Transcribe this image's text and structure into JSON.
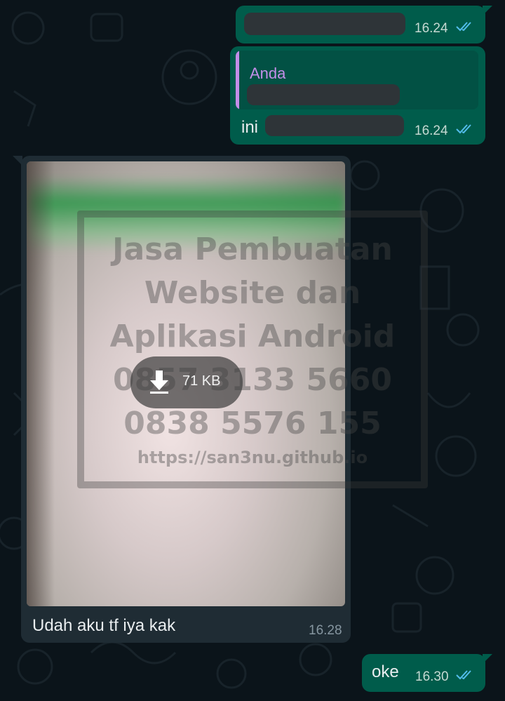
{
  "colors": {
    "background": "#0b141a",
    "outgoing_bubble": "#005c4b",
    "incoming_bubble": "#1f2c34",
    "quote_author": "#c38ee8",
    "read_ticks": "#53bdeb"
  },
  "messages": [
    {
      "direction": "outgoing",
      "text_redacted": true,
      "time": "16.24",
      "status_icon": "double-check-read-icon"
    },
    {
      "direction": "outgoing",
      "reply": {
        "author": "Anda",
        "text_redacted": true
      },
      "text": "ini",
      "time": "16.24",
      "status_icon": "double-check-read-icon"
    },
    {
      "direction": "incoming",
      "media": {
        "type": "image",
        "size_label": "71 KB",
        "download_icon": "download-arrow-icon",
        "watermark": [
          "Jasa Pembuatan",
          "Website dan",
          "Aplikasi Android",
          "0857 3133 5660",
          "0838 5576 155",
          "https://san3nu.github.io"
        ]
      },
      "caption": "Udah aku tf iya kak",
      "time": "16.28"
    },
    {
      "direction": "outgoing",
      "text": "oke",
      "time": "16.30",
      "status_icon": "double-check-read-icon"
    }
  ]
}
